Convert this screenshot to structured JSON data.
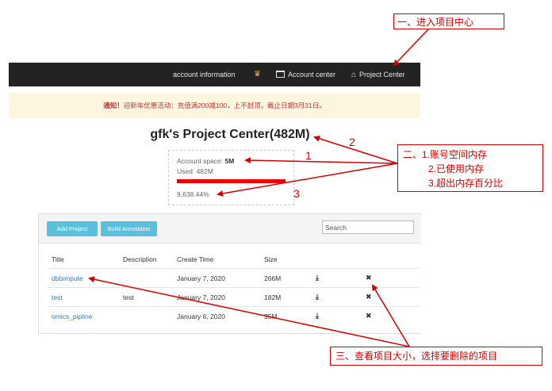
{
  "nav": {
    "account_information": "account information",
    "crown_icon": "crown-icon",
    "account_center": "Account center",
    "project_center": "Project Center"
  },
  "notice": {
    "prefix": "通知！",
    "text": "迎新年优惠活动：充值满200减100，上不封顶，截止日期3月31日。"
  },
  "page_title": "gfk's Project Center(482M)",
  "account": {
    "space_label": "Account space: ",
    "space_value": "5M",
    "used": "Used: 482M",
    "percent": "9,638.44%",
    "bar_fill_fraction": 1.0
  },
  "toolbar": {
    "add_project": "Add Project",
    "build_annotation": "Build Annotation",
    "search_placeholder": "Search"
  },
  "table": {
    "headers": [
      "Title",
      "Description",
      "Create Time",
      "Size"
    ],
    "rows": [
      {
        "title": "dbbimpute",
        "description": "",
        "create_time": "January 7, 2020",
        "size": "266M"
      },
      {
        "title": "test",
        "description": "test",
        "create_time": "January 7, 2020",
        "size": "182M"
      },
      {
        "title": "omics_pipline",
        "description": "",
        "create_time": "January 6, 2020",
        "size": "35M"
      }
    ]
  },
  "annotations": {
    "step1": "一、进入项目中心",
    "step2_line1": "二、1.账号空间内存",
    "step2_line2": "2.已使用内存",
    "step2_line3": "3.超出内存百分比",
    "step3": "三、查看项目大小，选择要删除的项目",
    "num1": "1",
    "num2": "2",
    "num3": "3"
  },
  "colors": {
    "navbar": "#232323",
    "notice_bg": "#fcf6e0",
    "notice_text": "#c9302c",
    "button": "#5bc0de",
    "link": "#337ab7",
    "annotation": "#d40000",
    "usage_bar": "#ee0000"
  }
}
